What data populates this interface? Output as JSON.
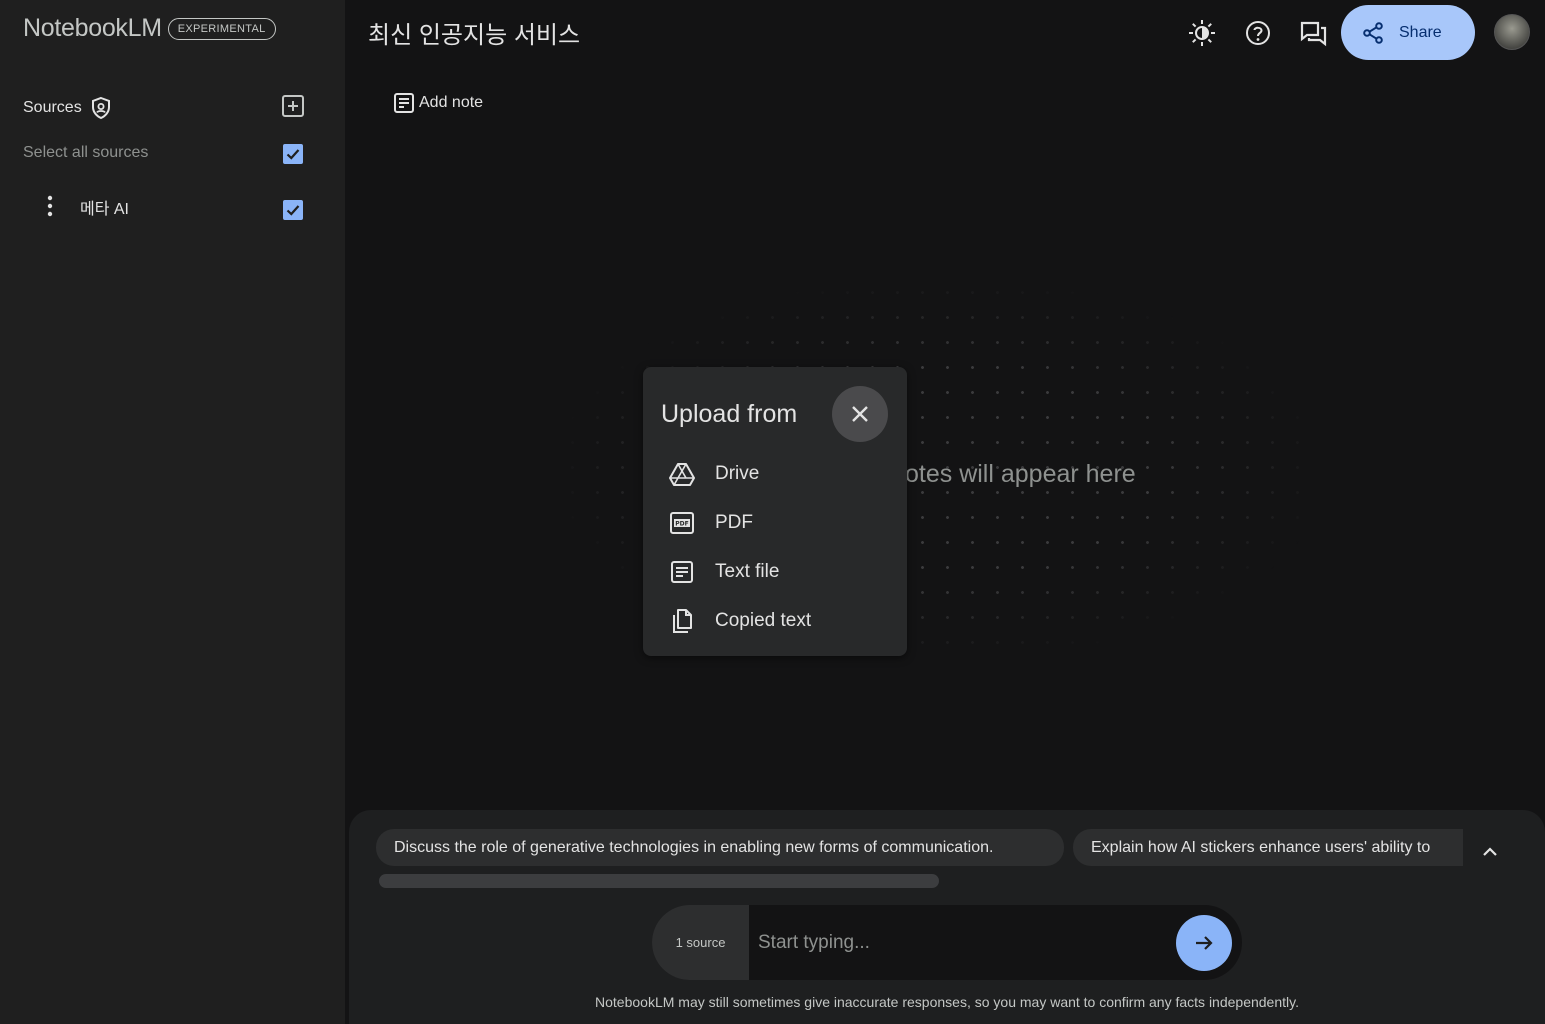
{
  "app": {
    "brand_name": "NotebookLM",
    "brand_badge": "EXPERIMENTAL"
  },
  "sidebar": {
    "sources_label": "Sources",
    "select_all_label": "Select all sources",
    "select_all_checked": true,
    "sources": [
      {
        "name": "메타 AI",
        "checked": true
      }
    ]
  },
  "header": {
    "notebook_title": "최신 인공지능 서비스",
    "share_label": "Share"
  },
  "notes": {
    "add_note_label": "Add note",
    "empty_text": "otes will appear here"
  },
  "upload_popup": {
    "title": "Upload from",
    "items": [
      {
        "label": "Drive",
        "icon": "drive-icon"
      },
      {
        "label": "PDF",
        "icon": "pdf-icon"
      },
      {
        "label": "Text file",
        "icon": "text-file-icon"
      },
      {
        "label": "Copied text",
        "icon": "copy-icon"
      }
    ]
  },
  "chat": {
    "suggestions": [
      "Discuss the role of generative technologies in enabling new forms of communication.",
      "Explain how AI stickers enhance users' ability to"
    ],
    "source_count": "1 source",
    "input_placeholder": "Start typing...",
    "disclaimer": "NotebookLM may still sometimes give inaccurate responses, so you may want to confirm any facts independently."
  },
  "colors": {
    "accent": "#8ab4f8",
    "share_bg": "#a8c7fa",
    "background": "#131314",
    "panel": "#1f1f1f"
  }
}
